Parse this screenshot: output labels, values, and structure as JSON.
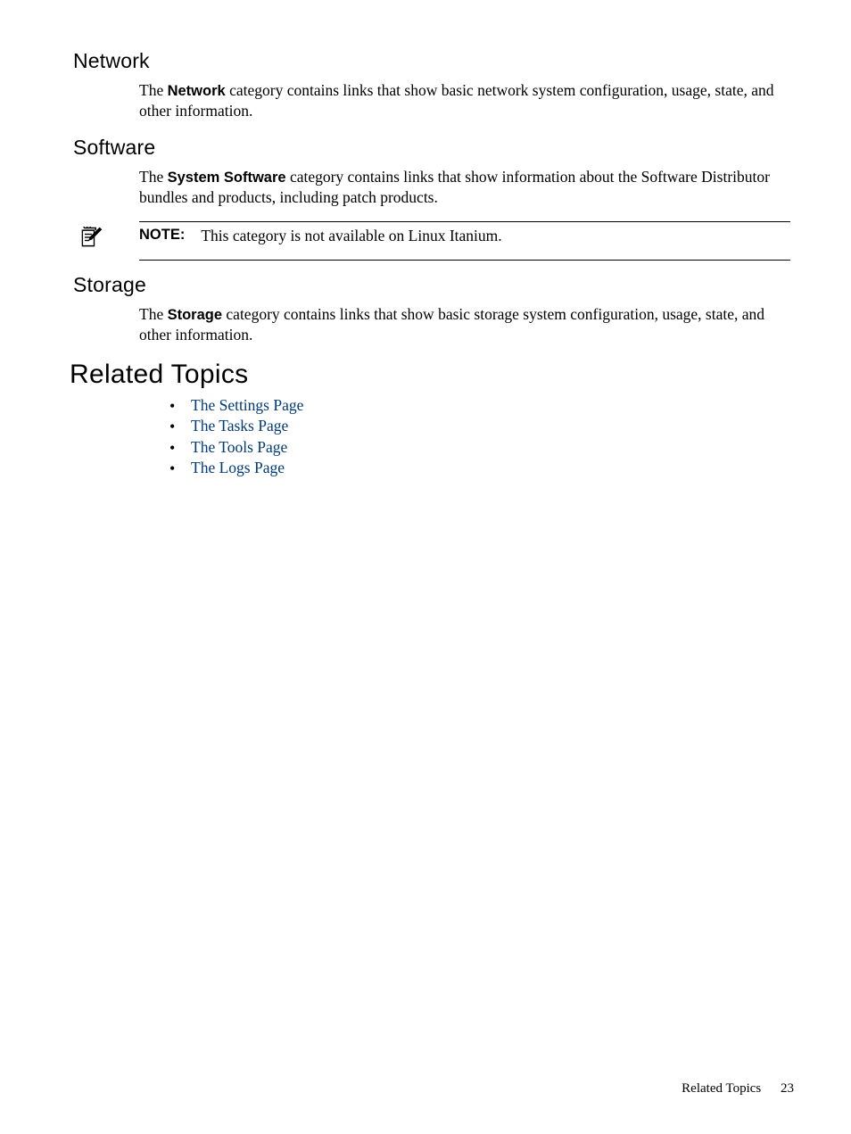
{
  "sections": {
    "network": {
      "heading": "Network",
      "para_pre": "The ",
      "para_bold": "Network",
      "para_post": " category contains links that show basic network system configuration, usage, state, and other information."
    },
    "software": {
      "heading": "Software",
      "para_pre": "The ",
      "para_bold": "System Software",
      "para_post": " category contains links that show information about the Software Distributor bundles and products, including patch products."
    },
    "note": {
      "label": "NOTE:",
      "text": "This category is not available on Linux Itanium."
    },
    "storage": {
      "heading": "Storage",
      "para_pre": "The ",
      "para_bold": "Storage",
      "para_post": " category contains links that show basic storage system configuration, usage, state, and other information."
    },
    "related": {
      "heading": "Related Topics",
      "links": [
        "The Settings Page",
        "The Tasks Page",
        "The Tools Page",
        "The Logs Page"
      ]
    }
  },
  "footer": {
    "text": "Related Topics",
    "page_number": "23"
  }
}
